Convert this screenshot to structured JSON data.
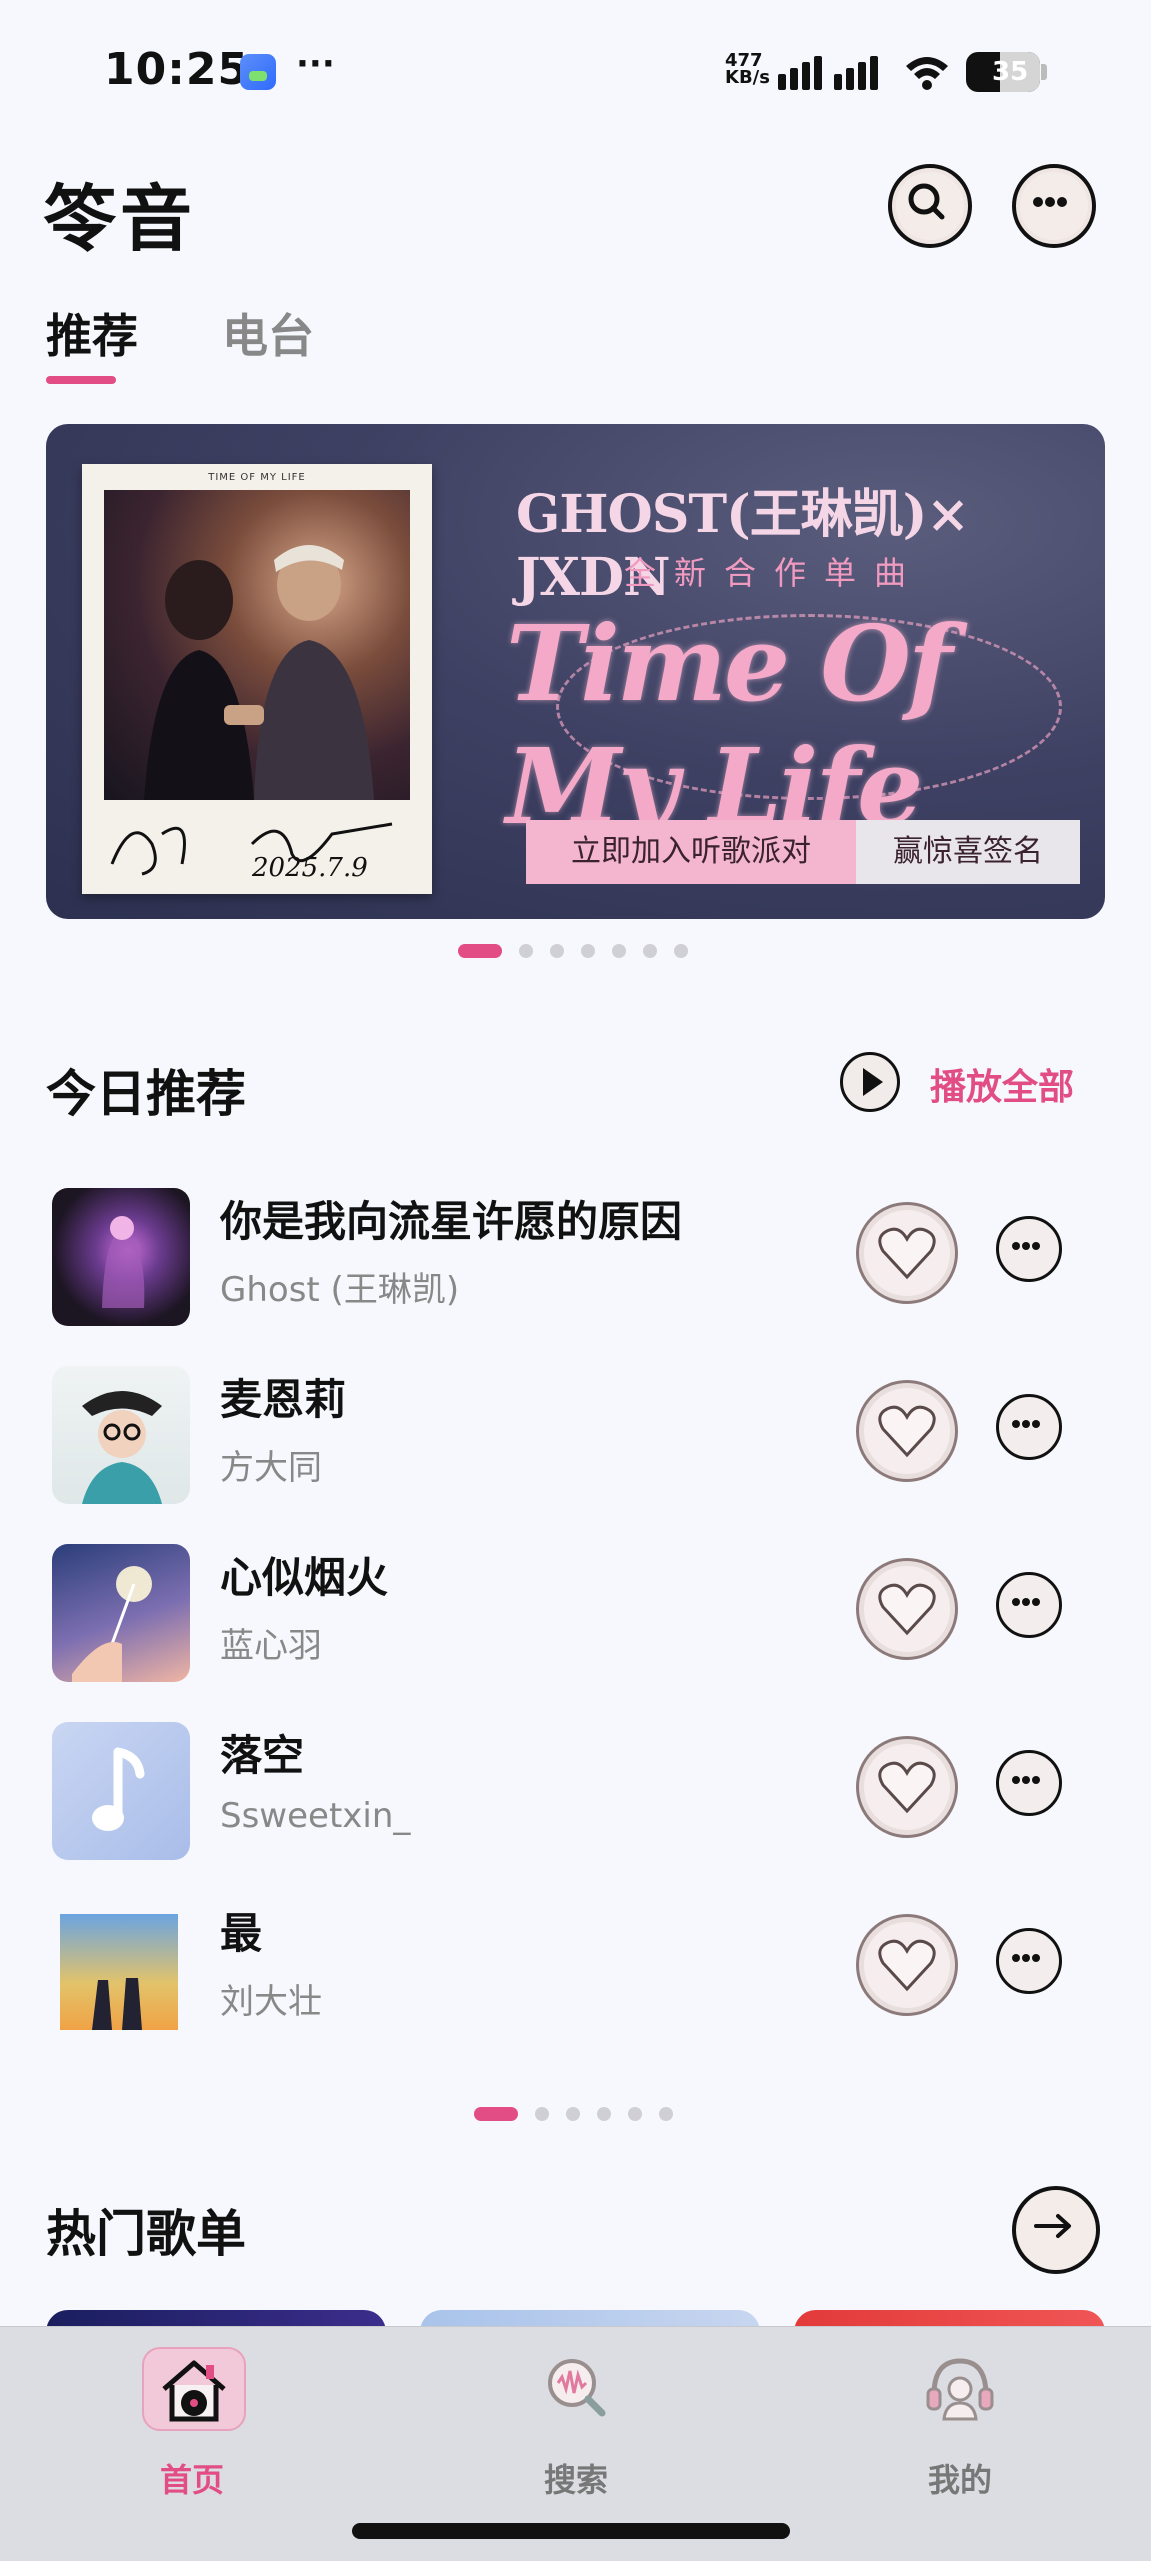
{
  "status_bar": {
    "time": "10:25",
    "dots": "···",
    "net_speed_value": "477",
    "net_speed_unit": "KB/s",
    "battery": "35"
  },
  "header": {
    "app_title": "笭音",
    "tabs": [
      {
        "label": "推荐",
        "active": true
      },
      {
        "label": "电台",
        "active": false
      }
    ]
  },
  "banner": {
    "polaroid_title": "TIME OF MY LIFE",
    "headline": "GHOST(王琳凯)× JXDN",
    "subtitle": "全新合作单曲",
    "song_title": "Time Of My Life",
    "signature_text": "2025.7.9",
    "button_primary": "立即加入听歌派对",
    "button_secondary": "赢惊喜签名",
    "page_count": 7,
    "active_page": 1
  },
  "today": {
    "title": "今日推荐",
    "play_all": "播放全部",
    "songs": [
      {
        "title": "你是我向流星许愿的原因",
        "artist": "Ghost (王琳凯)"
      },
      {
        "title": "麦恩莉",
        "artist": "方大同"
      },
      {
        "title": "心似烟火",
        "artist": "蓝心羽"
      },
      {
        "title": "落空",
        "artist": "Ssweetxin_"
      },
      {
        "title": "最",
        "artist": "刘大壮"
      }
    ],
    "page_count": 6,
    "active_page": 1
  },
  "hot": {
    "title": "热门歌单"
  },
  "nav": {
    "items": [
      {
        "label": "首页",
        "icon": "home-record-icon",
        "active": true
      },
      {
        "label": "搜索",
        "icon": "search-wave-icon",
        "active": false
      },
      {
        "label": "我的",
        "icon": "headphone-user-icon",
        "active": false
      }
    ]
  },
  "colors": {
    "accent": "#e24d86",
    "background": "#f6f8fd",
    "banner_bg": "#3e4163",
    "nav_bg": "#dcdde2"
  }
}
